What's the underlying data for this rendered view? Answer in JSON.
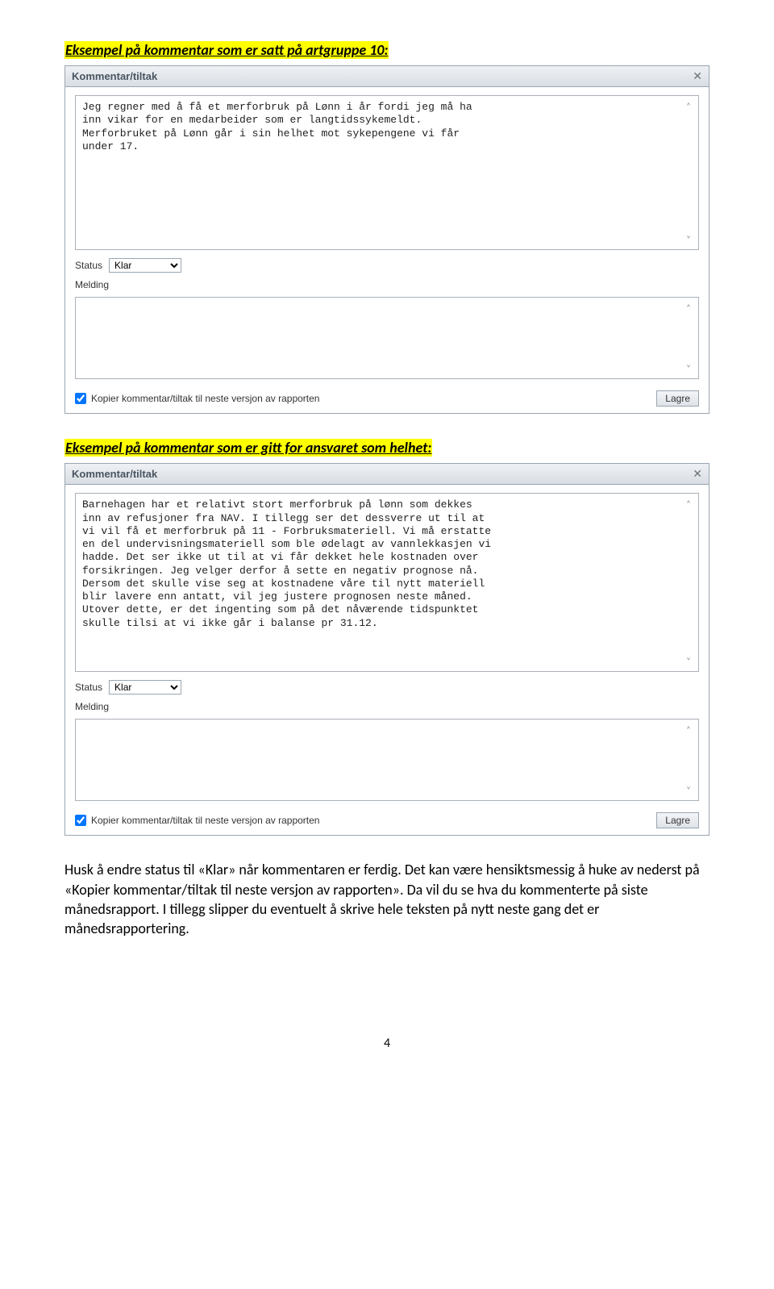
{
  "heading1": "Eksempel på kommentar som er satt på artgruppe 10:",
  "heading2": "Eksempel på kommentar som er gitt for ansvaret som helhet:",
  "panel1": {
    "title": "Kommentar/tiltak",
    "comment_text": "Jeg regner med å få et merforbruk på Lønn i år fordi jeg må ha\ninn vikar for en medarbeider som er langtidssykemeldt.\nMerforbruket på Lønn går i sin helhet mot sykepengene vi får\nunder 17.",
    "status_label": "Status",
    "status_value": "Klar",
    "melding_label": "Melding",
    "melding_text": "",
    "copy_label": "Kopier kommentar/tiltak til neste versjon av rapporten",
    "save_label": "Lagre"
  },
  "panel2": {
    "title": "Kommentar/tiltak",
    "comment_text": "Barnehagen har et relativt stort merforbruk på lønn som dekkes\ninn av refusjoner fra NAV. I tillegg ser det dessverre ut til at\nvi vil få et merforbruk på 11 - Forbruksmateriell. Vi må erstatte\nen del undervisningsmateriell som ble ødelagt av vannlekkasjen vi\nhadde. Det ser ikke ut til at vi får dekket hele kostnaden over\nforsikringen. Jeg velger derfor å sette en negativ prognose nå.\nDersom det skulle vise seg at kostnadene våre til nytt materiell\nblir lavere enn antatt, vil jeg justere prognosen neste måned.\nUtover dette, er det ingenting som på det nåværende tidspunktet\nskulle tilsi at vi ikke går i balanse pr 31.12.",
    "status_label": "Status",
    "status_value": "Klar",
    "melding_label": "Melding",
    "melding_text": "",
    "copy_label": "Kopier kommentar/tiltak til neste versjon av rapporten",
    "save_label": "Lagre"
  },
  "body_paragraph": "Husk å endre status til «Klar» når kommentaren er ferdig. Det kan være hensiktsmessig å huke av nederst på «Kopier kommentar/tiltak til neste versjon av rapporten». Da vil du se hva du kommenterte på siste månedsrapport. I tillegg slipper du eventuelt å skrive hele teksten på nytt neste gang det er månedsrapportering.",
  "page_number": "4"
}
